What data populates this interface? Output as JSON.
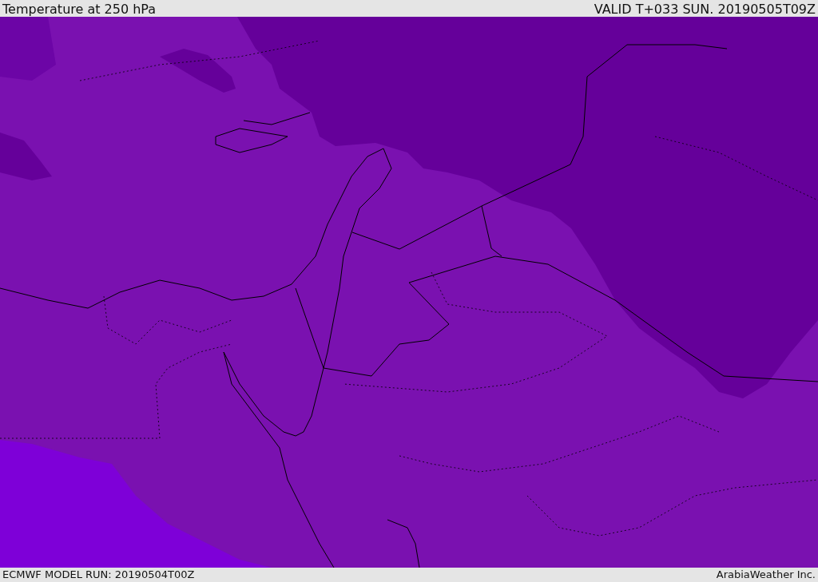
{
  "header": {
    "title": "Temperature at 250 hPa",
    "valid": "VALID T+033 SUN. 20190505T09Z"
  },
  "footer": {
    "model_run": "ECMWF MODEL RUN: 20190504T00Z",
    "credit": "ArabiaWeather Inc."
  }
}
